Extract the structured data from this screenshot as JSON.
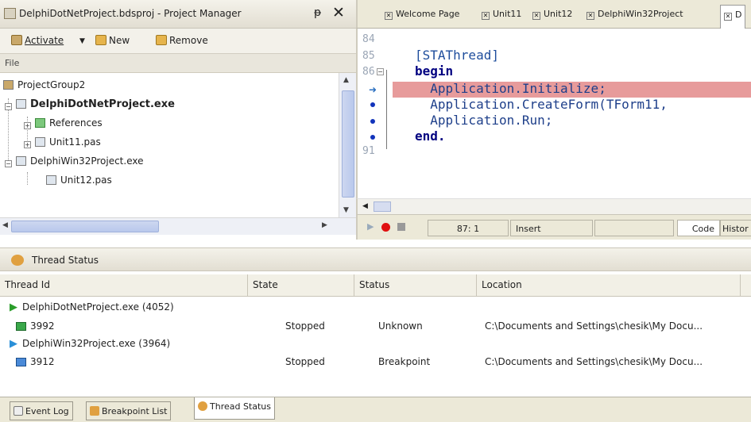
{
  "project_manager": {
    "title": "DelphiDotNetProject.bdsproj - Project Manager",
    "pin": "ᵽ",
    "close": "✕",
    "toolbar": {
      "activate": "Activate",
      "new": "New",
      "remove": "Remove"
    },
    "file_label": "File",
    "tree": {
      "group": "ProjectGroup2",
      "project1": "DelphiDotNetProject.exe",
      "references": "References",
      "unit11": "Unit11.pas",
      "project2": "DelphiWin32Project.exe",
      "unit12": "Unit12.pas"
    }
  },
  "editor": {
    "tabs": [
      "Welcome Page",
      "Unit11",
      "Unit12",
      "DelphiWin32Project",
      "D"
    ],
    "line_numbers": [
      "84",
      "85",
      "86",
      "",
      "",
      "",
      "",
      "91"
    ],
    "lines": {
      "l85": "[STAThread]",
      "l86": "begin",
      "l87": "  Application.Initialize;",
      "l88": "  Application.CreateForm(TForm11,",
      "l89": "  Application.Run;",
      "l90": "end."
    },
    "status": {
      "position": "87:  1",
      "mode": "Insert",
      "code_tab": "Code",
      "history_tab": "Histor"
    }
  },
  "thread_status": {
    "title": "Thread Status",
    "columns": [
      "Thread Id",
      "State",
      "Status",
      "Location"
    ],
    "rows": [
      {
        "process": "DelphiDotNetProject.exe (4052)",
        "thread": "3992",
        "state": "Stopped",
        "status": "Unknown",
        "location": "C:\\Documents and Settings\\chesik\\My Docu..."
      },
      {
        "process": "DelphiWin32Project.exe (3964)",
        "thread": "3912",
        "state": "Stopped",
        "status": "Breakpoint",
        "location": "C:\\Documents and Settings\\chesik\\My Docu..."
      }
    ]
  },
  "bottom_tabs": [
    "Event Log",
    "Breakpoint List",
    "Thread Status"
  ],
  "colors": {
    "execution_line": "#e79b9b",
    "process_arrow_1": "#2a9d2a",
    "process_arrow_2": "#2a8fd8",
    "breakpoint": "#e01010"
  }
}
